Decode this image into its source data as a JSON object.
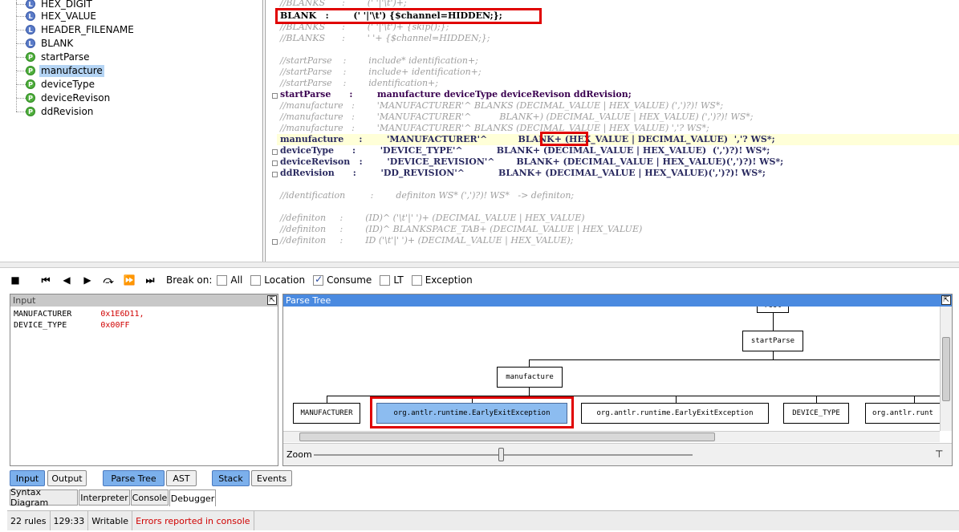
{
  "rules": [
    {
      "type": "L",
      "label": "HEX_DIGIT"
    },
    {
      "type": "L",
      "label": "HEX_VALUE"
    },
    {
      "type": "L",
      "label": "HEADER_FILENAME"
    },
    {
      "type": "L",
      "label": "BLANK"
    },
    {
      "type": "P",
      "label": "startParse"
    },
    {
      "type": "P",
      "label": "manufacture",
      "selected": true
    },
    {
      "type": "P",
      "label": "deviceType"
    },
    {
      "type": "P",
      "label": "deviceRevison"
    },
    {
      "type": "P",
      "label": "ddRevision"
    }
  ],
  "editor": {
    "lines": [
      "//BLANKS      :        (' '|'\\t')+;",
      "BLANK   :        (' '|'\\t') {$channel=HIDDEN;};",
      "//BLANKS      :        (' '|'\\t')+ {skip();};",
      "//BLANKS      :        ' '+ {$channel=HIDDEN;};",
      "",
      "//startParse    :        include* identification+;",
      "//startParse    :        include+ identification+;",
      "//startParse    :        identification+;",
      "startParse      :        manufacture deviceType deviceRevison ddRevision;",
      "//manufacture   :        'MANUFACTURER'^ BLANKS (DECIMAL_VALUE | HEX_VALUE) (',')?)! WS*;",
      "//manufacture   :        'MANUFACTURER'^          BLANK+) (DECIMAL_VALUE | HEX_VALUE) (',')?)! WS*;",
      "//manufacture   :        'MANUFACTURER'^ BLANKS (DECIMAL_VALUE | HEX_VALUE) ','? WS*;",
      "manufacture     :        'MANUFACTURER'^          BLANK+ (HEX_VALUE | DECIMAL_VALUE)  ','? WS*;",
      "deviceType      :        'DEVICE_TYPE'^           BLANK+ (DECIMAL_VALUE | HEX_VALUE)  (',')?)! WS*;",
      "deviceRevison   :        'DEVICE_REVISION'^       BLANK+ (DECIMAL_VALUE | HEX_VALUE)(',')?)! WS*;",
      "ddRevision      :        'DD_REVISION'^           BLANK+ (DECIMAL_VALUE | HEX_VALUE)(',')?)! WS*;",
      "",
      "//identification         :        definiton WS* (',')?)! WS*   -> definiton;",
      "",
      "//definiton     :        (ID)^ ('\\t'|' ')+ (DECIMAL_VALUE | HEX_VALUE)",
      "//definiton     :        (ID)^ BLANKSPACE_TAB+ (DECIMAL_VALUE | HEX_VALUE)",
      "//definiton     :        ID ('\\t'|' ')+ (DECIMAL_VALUE | HEX_VALUE);"
    ]
  },
  "toolbar": {
    "break_on_label": "Break on:",
    "checks": [
      {
        "label": "All",
        "checked": false
      },
      {
        "label": "Location",
        "checked": false
      },
      {
        "label": "Consume",
        "checked": true
      },
      {
        "label": "LT",
        "checked": false
      },
      {
        "label": "Exception",
        "checked": false
      }
    ]
  },
  "input_panel": {
    "title": "Input",
    "rows": [
      {
        "key": "MANUFACTURER",
        "value": "0x1E6D11,"
      },
      {
        "key": "DEVICE_TYPE",
        "value": "0x00FF"
      }
    ]
  },
  "parse_tree": {
    "title": "Parse Tree",
    "root": "root",
    "start": "startParse",
    "manufacture": "manufacture",
    "leaves": [
      "MANUFACTURER",
      "org.antlr.runtime.EarlyExitException",
      "org.antlr.runtime.EarlyExitException",
      "DEVICE_TYPE",
      "org.antlr.runt"
    ],
    "zoom_label": "Zoom"
  },
  "bottom_buttons": {
    "input": "Input",
    "output": "Output",
    "parse_tree": "Parse Tree",
    "ast": "AST",
    "stack": "Stack",
    "events": "Events"
  },
  "tabs": [
    "Syntax Diagram",
    "Interpreter",
    "Console",
    "Debugger"
  ],
  "status": {
    "rules": "22 rules",
    "position": "129:33",
    "mode": "Writable",
    "error": "Errors reported in console"
  }
}
